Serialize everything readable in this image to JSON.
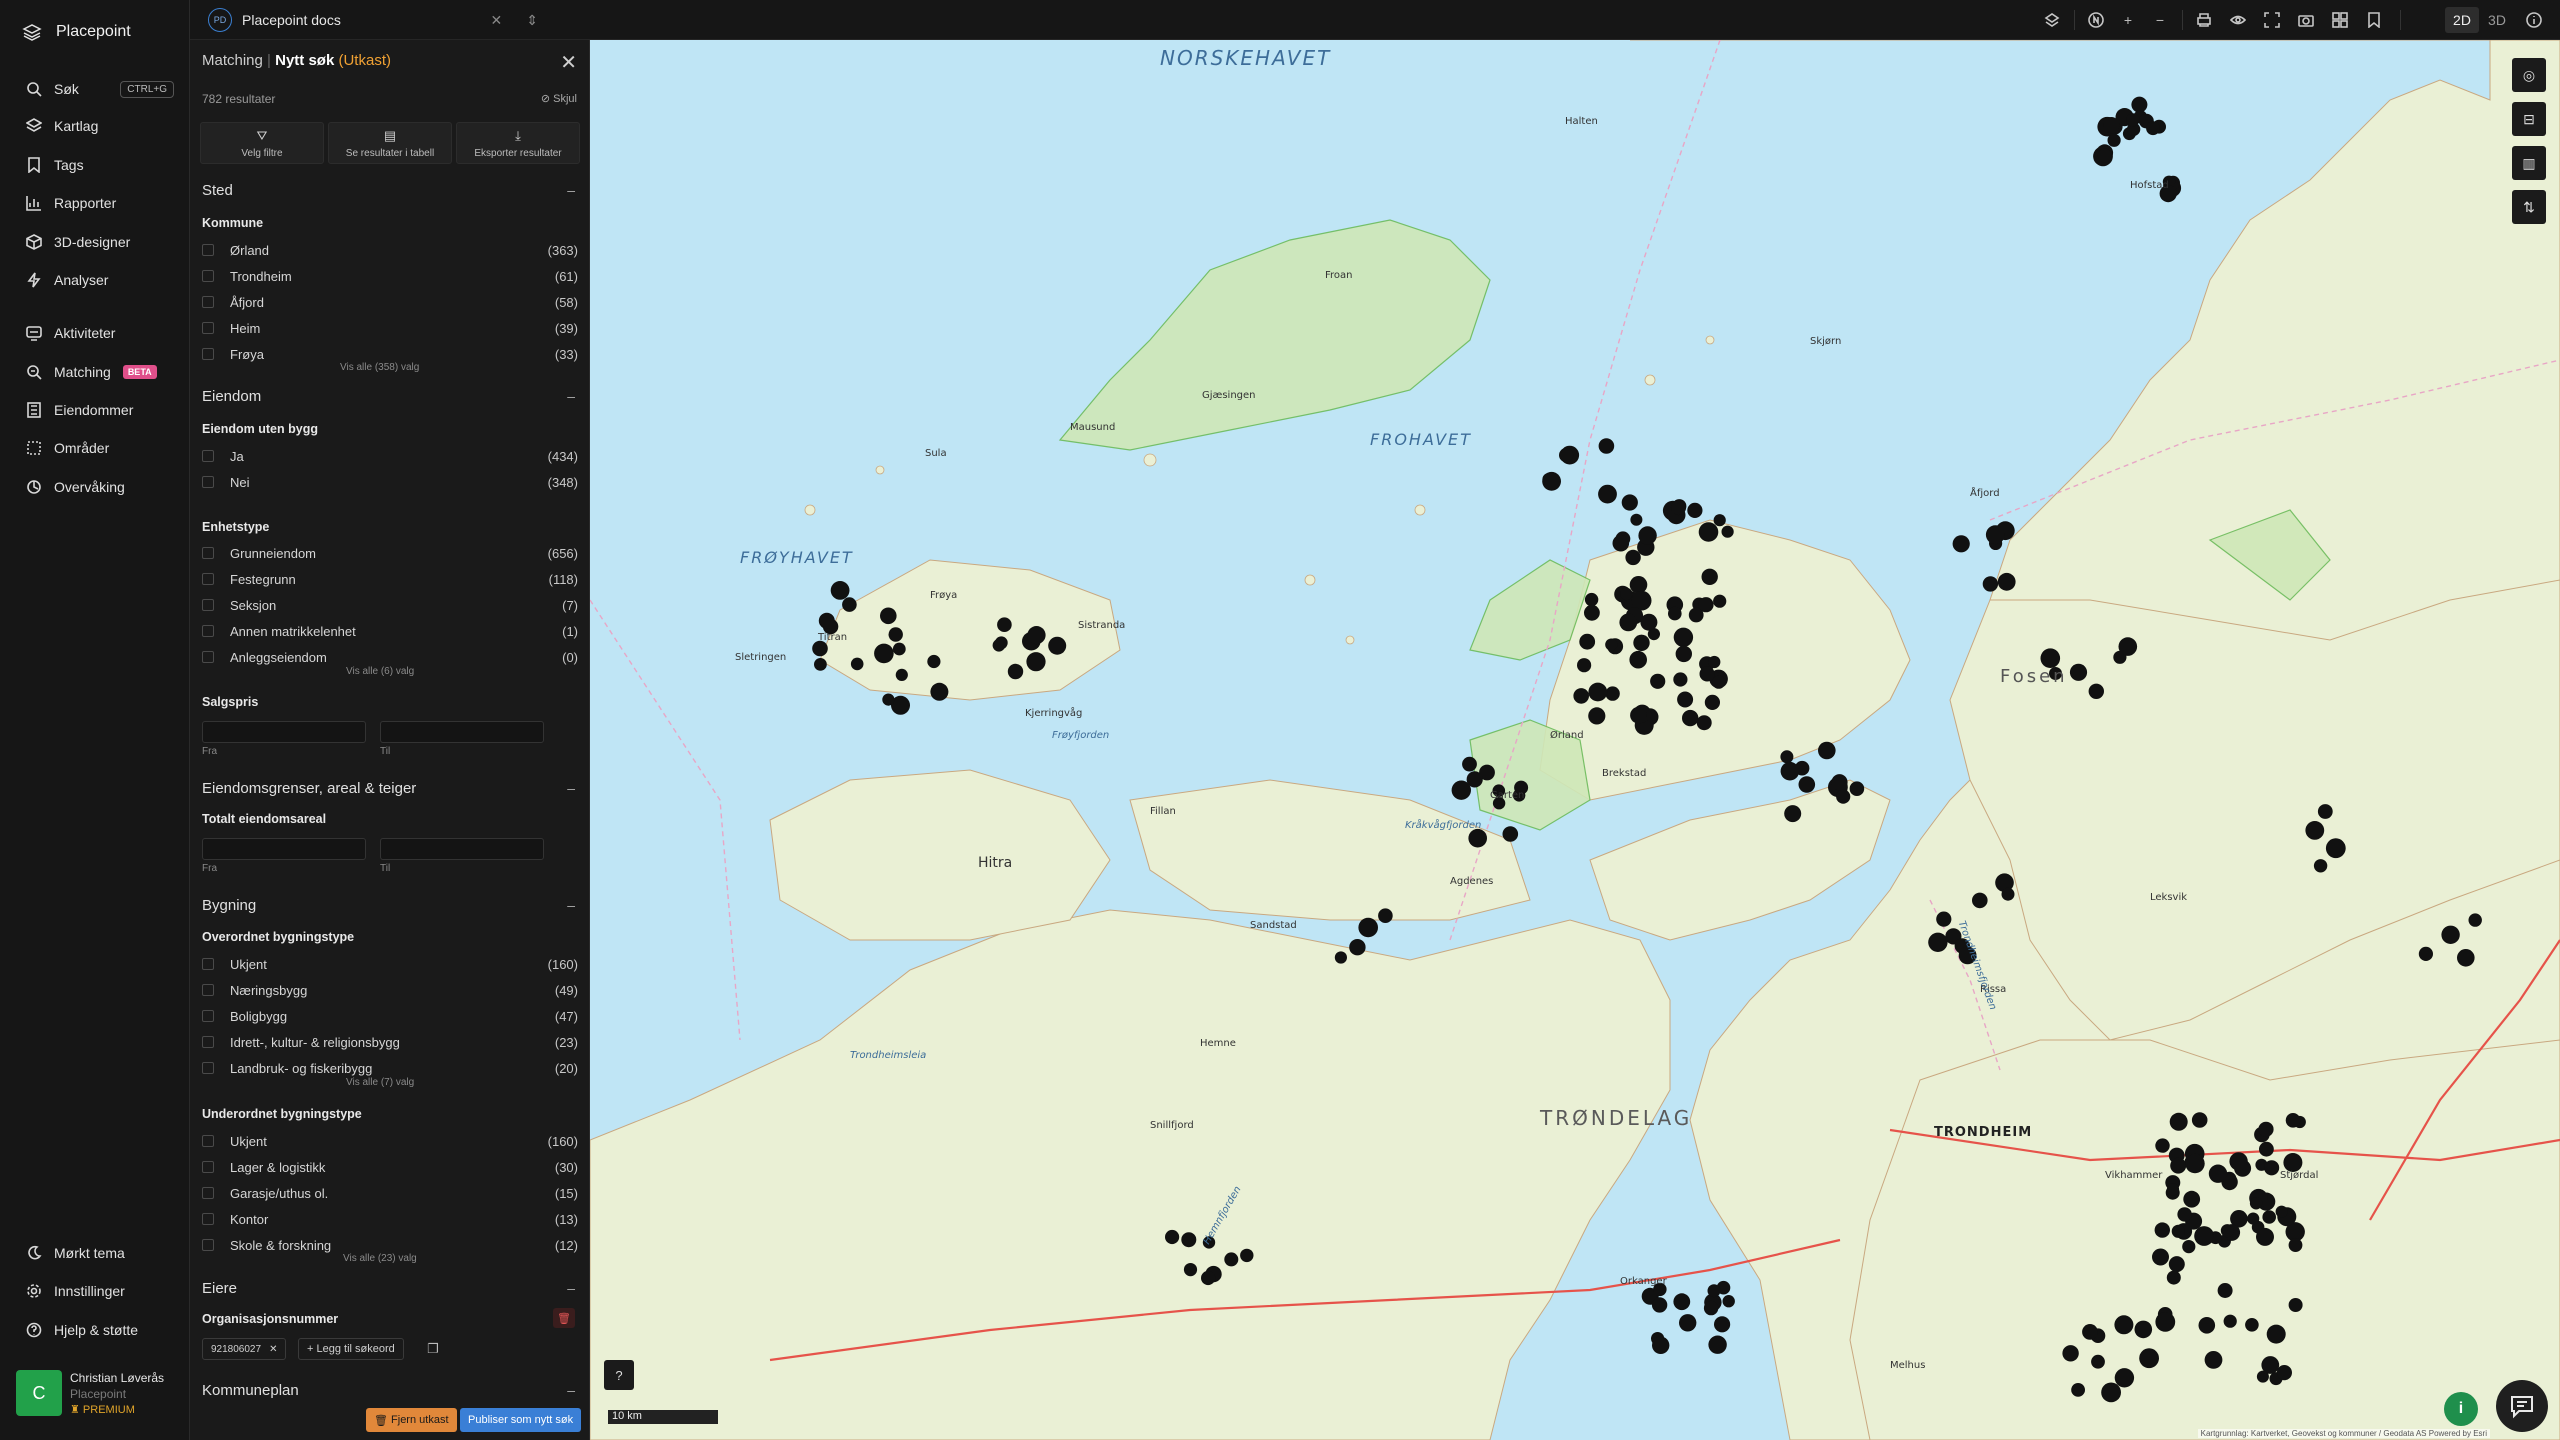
{
  "app": {
    "name": "Placepoint"
  },
  "nav": {
    "search": {
      "label": "Søk",
      "shortcut": "CTRL+G"
    },
    "items": [
      {
        "label": "Kartlag",
        "icon": "layers-icon"
      },
      {
        "label": "Tags",
        "icon": "bookmark-icon"
      },
      {
        "label": "Rapporter",
        "icon": "chart-icon"
      },
      {
        "label": "3D-designer",
        "icon": "cube-icon"
      },
      {
        "label": "Analyser",
        "icon": "bolt-icon"
      },
      {
        "label": "Aktiviteter",
        "icon": "activity-icon"
      },
      {
        "label": "Matching",
        "icon": "search-doc-icon",
        "badge": "BETA"
      },
      {
        "label": "Eiendommer",
        "icon": "building-icon"
      },
      {
        "label": "Områder",
        "icon": "area-icon"
      },
      {
        "label": "Overvåking",
        "icon": "eye-icon"
      }
    ],
    "bottom": [
      {
        "label": "Mørkt tema",
        "icon": "moon-icon"
      },
      {
        "label": "Innstillinger",
        "icon": "gear-icon"
      },
      {
        "label": "Hjelp & støtte",
        "icon": "help-icon"
      }
    ]
  },
  "user": {
    "initial": "C",
    "name": "Christian Løverås",
    "org": "Placepoint",
    "plan": "PREMIUM"
  },
  "topbar": {
    "doc_badge": "PD",
    "doc_name": "Placepoint docs",
    "mode_2d": "2D",
    "mode_3d": "3D"
  },
  "panel": {
    "breadcrumb": "Matching",
    "title": "Nytt søk",
    "draft": "(Utkast)",
    "result_count": "782 resultater",
    "hide_label": "Skjul",
    "tools": [
      {
        "label": "Velg filtre",
        "icon": "filter-icon"
      },
      {
        "label": "Se resultater i tabell",
        "icon": "table-icon"
      },
      {
        "label": "Eksporter resultater",
        "icon": "download-icon"
      }
    ],
    "sections": {
      "sted": {
        "title": "Sted",
        "kommune": {
          "title": "Kommune",
          "options": [
            {
              "label": "Ørland",
              "count": "(363)"
            },
            {
              "label": "Trondheim",
              "count": "(61)"
            },
            {
              "label": "Åfjord",
              "count": "(58)"
            },
            {
              "label": "Heim",
              "count": "(39)"
            },
            {
              "label": "Frøya",
              "count": "(33)"
            }
          ],
          "show_all": "Vis alle (358) valg"
        }
      },
      "eiendom": {
        "title": "Eiendom",
        "uten_bygg": {
          "title": "Eiendom uten bygg",
          "options": [
            {
              "label": "Ja",
              "count": "(434)"
            },
            {
              "label": "Nei",
              "count": "(348)"
            }
          ]
        },
        "enhetstype": {
          "title": "Enhetstype",
          "options": [
            {
              "label": "Grunneiendom",
              "count": "(656)"
            },
            {
              "label": "Festegrunn",
              "count": "(118)"
            },
            {
              "label": "Seksjon",
              "count": "(7)"
            },
            {
              "label": "Annen matrikkelenhet",
              "count": "(1)"
            },
            {
              "label": "Anleggseiendom",
              "count": "(0)"
            }
          ],
          "show_all": "Vis alle (6) valg"
        },
        "salgspris": {
          "title": "Salgspris",
          "from": "Fra",
          "to": "Til"
        }
      },
      "grenser": {
        "title": "Eiendomsgrenser, areal & teiger",
        "areal": {
          "title": "Totalt eiendomsareal",
          "from": "Fra",
          "to": "Til"
        }
      },
      "bygning": {
        "title": "Bygning",
        "overordnet": {
          "title": "Overordnet bygningstype",
          "options": [
            {
              "label": "Ukjent",
              "count": "(160)"
            },
            {
              "label": "Næringsbygg",
              "count": "(49)"
            },
            {
              "label": "Boligbygg",
              "count": "(47)"
            },
            {
              "label": "Idrett-, kultur- & religionsbygg",
              "count": "(23)"
            },
            {
              "label": "Landbruk- og fiskeribygg",
              "count": "(20)"
            }
          ],
          "show_all": "Vis alle (7) valg"
        },
        "underordnet": {
          "title": "Underordnet bygningstype",
          "options": [
            {
              "label": "Ukjent",
              "count": "(160)"
            },
            {
              "label": "Lager & logistikk",
              "count": "(30)"
            },
            {
              "label": "Garasje/uthus ol.",
              "count": "(15)"
            },
            {
              "label": "Kontor",
              "count": "(13)"
            },
            {
              "label": "Skole & forskning",
              "count": "(12)"
            }
          ],
          "show_all": "Vis alle (23) valg"
        }
      },
      "eiere": {
        "title": "Eiere",
        "orgnr_title": "Organisasjonsnummer",
        "orgnr_value": "921806027",
        "add_keyword": "Legg til søkeord"
      },
      "kommuneplan": {
        "title": "Kommuneplan"
      }
    },
    "actions": {
      "remove_draft": "Fjern utkast",
      "publish": "Publiser som nytt søk"
    }
  },
  "map": {
    "seas": [
      "NORSKEHAVET",
      "FROHAVET",
      "FRØYHAVET"
    ],
    "regions": [
      "TRØNDELAG",
      "Fosen"
    ],
    "city": "TRONDHEIM",
    "places": [
      "Halten",
      "Froan",
      "Frøya",
      "Hitra",
      "Ørland",
      "Brekstad",
      "Agdenes",
      "Hemne",
      "Snillfjord",
      "Orkanger",
      "Melhus",
      "Stjørdal",
      "Leksvik",
      "Rissa",
      "Åfjord",
      "Hofstad",
      "Skjørn",
      "Sula",
      "Titran",
      "Sistranda",
      "Sletringen",
      "Kjerringvåg",
      "Fillan",
      "Sandstad",
      "Garten",
      "Vikhammer",
      "Mausund",
      "Gjæsingen"
    ],
    "waters": [
      "Frøyfjorden",
      "Trondheimsleia",
      "Trondheimsfjorden",
      "Kråkvågfjorden",
      "Hemnfjorden"
    ],
    "scale_label": "10 km",
    "attribution": "Kartgrunnlag: Kartverket, Geovekst og kommuner / Geodata AS Powered by Esri",
    "point_count": 782
  }
}
